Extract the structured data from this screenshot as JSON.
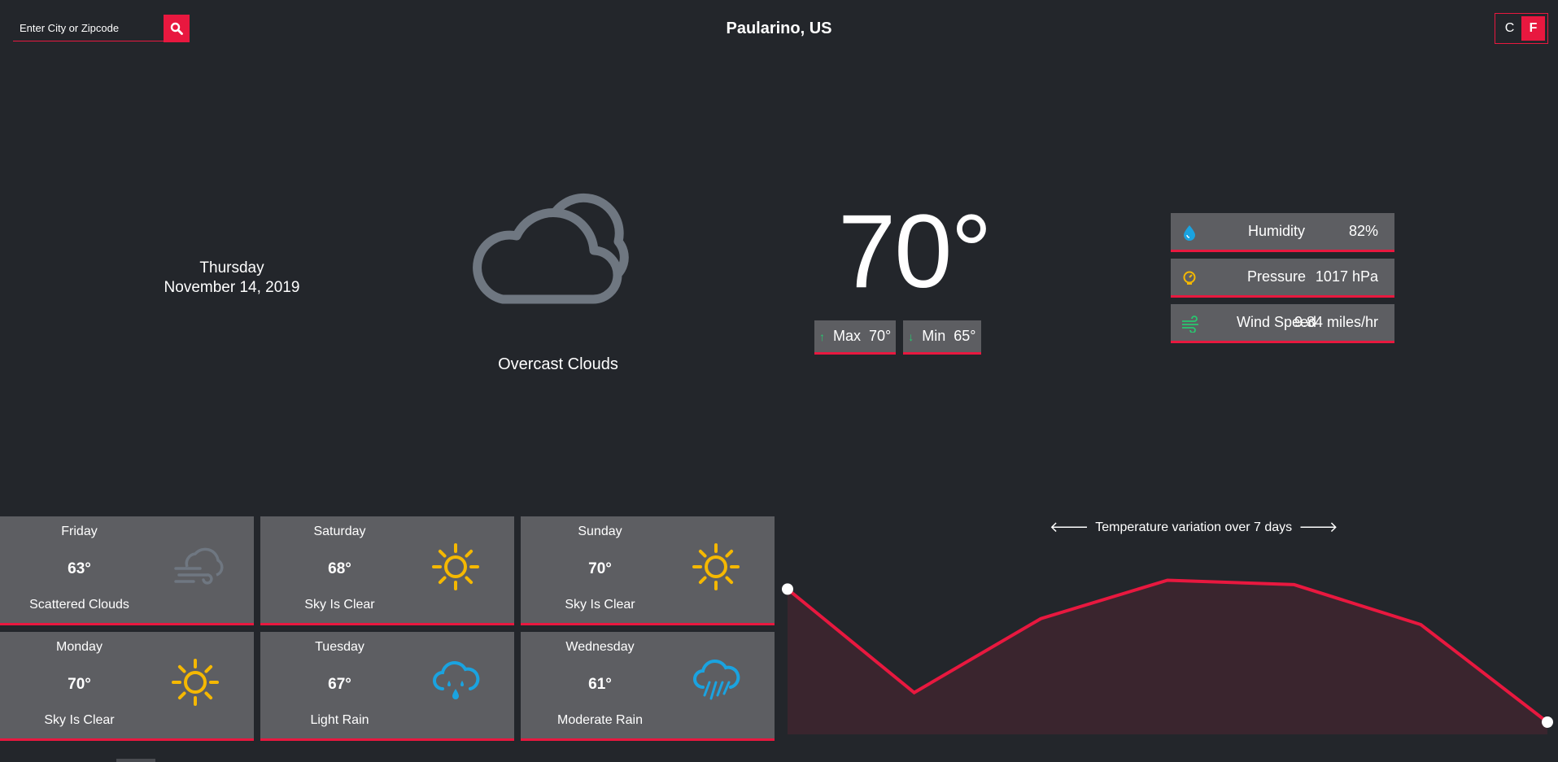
{
  "search": {
    "placeholder": "Enter City or Zipcode",
    "button_icon": "search-icon"
  },
  "location": "Paularino, US",
  "units": {
    "celsius": "C",
    "fahrenheit": "F",
    "active": "F"
  },
  "current": {
    "day": "Thursday",
    "date": "November 14, 2019",
    "icon": "overcast-clouds-icon",
    "condition": "Overcast Clouds",
    "temperature": "70°",
    "max_label": "Max",
    "max_value": "70°",
    "min_label": "Min",
    "min_value": "65°"
  },
  "stats": [
    {
      "label": "Humidity",
      "value": "82%",
      "icon": "humidity-drop-icon"
    },
    {
      "label": "Pressure",
      "value": "1017 hPa",
      "icon": "pressure-gauge-icon"
    },
    {
      "label": "Wind Speed",
      "value": "9.84 miles/hr",
      "icon": "wind-icon"
    }
  ],
  "forecast": [
    {
      "day": "Friday",
      "temp": "63°",
      "desc": "Scattered Clouds",
      "icon": "wind-cloud-icon"
    },
    {
      "day": "Saturday",
      "temp": "68°",
      "desc": "Sky Is Clear",
      "icon": "sun-icon"
    },
    {
      "day": "Sunday",
      "temp": "70°",
      "desc": "Sky Is Clear",
      "icon": "sun-icon"
    },
    {
      "day": "Monday",
      "temp": "70°",
      "desc": "Sky Is Clear",
      "icon": "sun-icon"
    },
    {
      "day": "Tuesday",
      "temp": "67°",
      "desc": "Light Rain",
      "icon": "rain-cloud-icon"
    },
    {
      "day": "Wednesday",
      "temp": "61°",
      "desc": "Moderate Rain",
      "icon": "heavy-rain-cloud-icon"
    }
  ],
  "colors": {
    "accent": "#e8183f",
    "background": "#23262b",
    "card": "#5d5e62",
    "sun": "#f5b800",
    "rain": "#1aa3e0",
    "cloud": "#6f7781",
    "up_arrow": "#28c76f"
  },
  "chart_data": {
    "type": "area",
    "title": "Temperature variation over 7 days",
    "y": [
      70,
      63,
      68,
      70.6,
      70.3,
      67.6,
      61
    ],
    "ylim": [
      61,
      72
    ],
    "grid": false,
    "line_color": "#e8183f",
    "fill_color": "#3a252e"
  }
}
